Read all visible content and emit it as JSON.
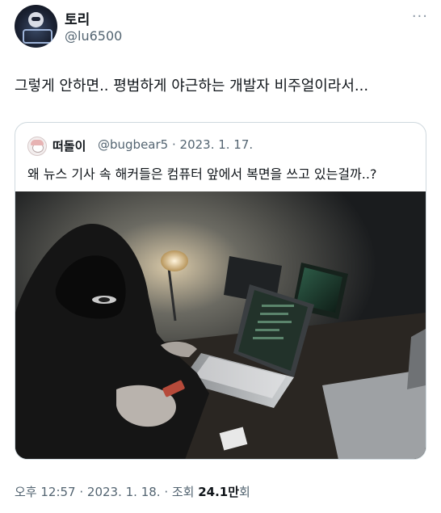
{
  "tweet": {
    "author_name": "토리",
    "author_handle": "@lu6500",
    "more_label": "···",
    "text": "그렇게 안하면.. 평범하게 야근하는 개발자 비주얼이라서...",
    "timestamp": "오후 12:57 · 2023. 1. 18.",
    "views_label": " · 조회 ",
    "views_count": "24.1만",
    "views_suffix": "회"
  },
  "quoted": {
    "author_name": "떠돌이",
    "author_handle": "@bugbear5",
    "date": "· 2023. 1. 17.",
    "text": "왜 뉴스 기사 속 해커들은 컴퓨터 앞에서 복면을 쓰고 있는걸까..?"
  }
}
